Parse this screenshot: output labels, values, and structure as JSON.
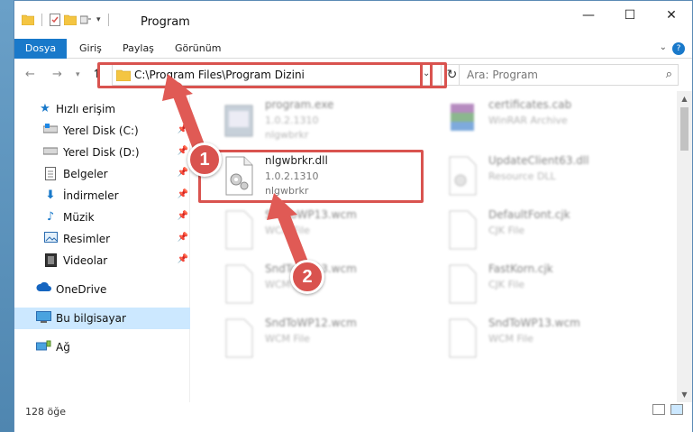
{
  "window": {
    "title": "Program"
  },
  "ribbon": {
    "tabs": [
      "Dosya",
      "Giriş",
      "Paylaş",
      "Görünüm"
    ]
  },
  "address": {
    "path": "C:\\Program Files\\Program Dizini"
  },
  "search": {
    "placeholder": "Ara: Program"
  },
  "sidebar": {
    "quick_access": "Hızlı erişim",
    "items": [
      {
        "label": "Yerel Disk (C:)",
        "icon": "drive-icon"
      },
      {
        "label": "Yerel Disk (D:)",
        "icon": "drive-icon"
      },
      {
        "label": "Belgeler",
        "icon": "documents-icon"
      },
      {
        "label": "İndirmeler",
        "icon": "download-icon"
      },
      {
        "label": "Müzik",
        "icon": "music-icon"
      },
      {
        "label": "Resimler",
        "icon": "pictures-icon"
      },
      {
        "label": "Videolar",
        "icon": "videos-icon"
      }
    ],
    "onedrive": "OneDrive",
    "this_pc": "Bu bilgisayar",
    "network": "Ağ"
  },
  "files": [
    {
      "name": "program.exe",
      "line2": "1.0.2.1310",
      "line3": "nlgwbrkr"
    },
    {
      "name": "certificates.cab",
      "line2": "WinRAR Archive",
      "line3": ""
    },
    {
      "name": "nlgwbrkr.dll",
      "line2": "1.0.2.1310",
      "line3": "nlgwbrkr"
    },
    {
      "name": "UpdateClient63.dll",
      "line2": "Resource DLL",
      "line3": ""
    },
    {
      "name": "SndToWP13.wcm",
      "line2": "WCM File",
      "line3": ""
    },
    {
      "name": "DefaultFont.cjk",
      "line2": "CJK File",
      "line3": ""
    },
    {
      "name": "SndToWP13.wcm",
      "line2": "WCM File",
      "line3": ""
    },
    {
      "name": "FastKorn.cjk",
      "line2": "CJK File",
      "line3": ""
    },
    {
      "name": "SndToWP12.wcm",
      "line2": "WCM File",
      "line3": ""
    },
    {
      "name": "SndToWP13.wcm",
      "line2": "WCM File",
      "line3": ""
    }
  ],
  "status": {
    "count": "128 öğe"
  },
  "annotations": {
    "step1": "1",
    "step2": "2"
  },
  "colors": {
    "accent": "#1979ca",
    "highlight": "#d9534f",
    "selection": "#cce8ff"
  }
}
